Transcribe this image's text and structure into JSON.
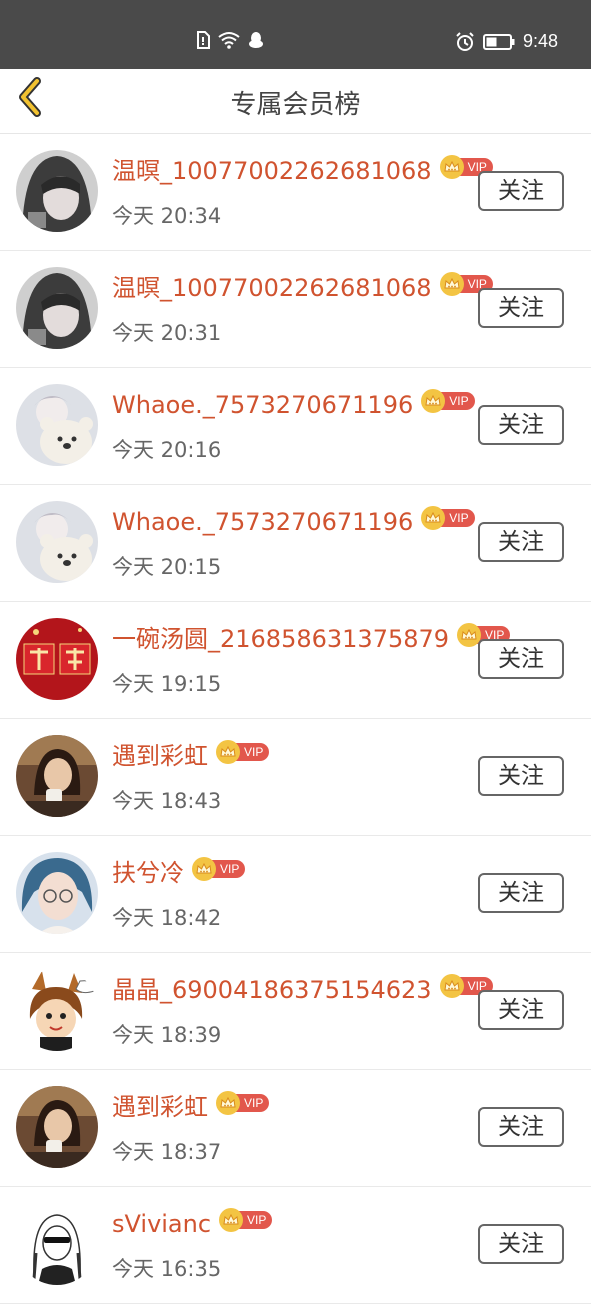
{
  "status_bar": {
    "time": "9:48"
  },
  "header": {
    "title": "专属会员榜"
  },
  "vip_label": "VIP",
  "colors": {
    "name": "#d0532f",
    "vip": "#e2574c",
    "crown": "#f3c443",
    "back_arrow": "#e8b623"
  },
  "members": [
    {
      "name": "温暝_10077002262681068",
      "time": "今天 20:34",
      "follow": "关注",
      "avatar": "hooded-user"
    },
    {
      "name": "温暝_10077002262681068",
      "time": "今天 20:31",
      "follow": "关注",
      "avatar": "hooded-user"
    },
    {
      "name": "Whaoe._7573270671196",
      "time": "今天 20:16",
      "follow": "关注",
      "avatar": "anime-bear"
    },
    {
      "name": "Whaoe._7573270671196",
      "time": "今天 20:15",
      "follow": "关注",
      "avatar": "anime-bear"
    },
    {
      "name": "一碗汤圆_216858631375879",
      "time": "今天 19:15",
      "follow": "关注",
      "avatar": "red-jiayou"
    },
    {
      "name": "遇到彩虹",
      "time": "今天 18:43",
      "follow": "关注",
      "avatar": "girl-tea"
    },
    {
      "name": "扶兮冷",
      "time": "今天 18:42",
      "follow": "关注",
      "avatar": "anime-glasses"
    },
    {
      "name": "晶晶_69004186375154623",
      "time": "今天 18:39",
      "follow": "关注",
      "avatar": "cartoon-bunny"
    },
    {
      "name": "遇到彩虹",
      "time": "今天 18:37",
      "follow": "关注",
      "avatar": "girl-tea"
    },
    {
      "name": "sVivianc",
      "time": "今天 16:35",
      "follow": "关注",
      "avatar": "sketch-girl"
    }
  ]
}
